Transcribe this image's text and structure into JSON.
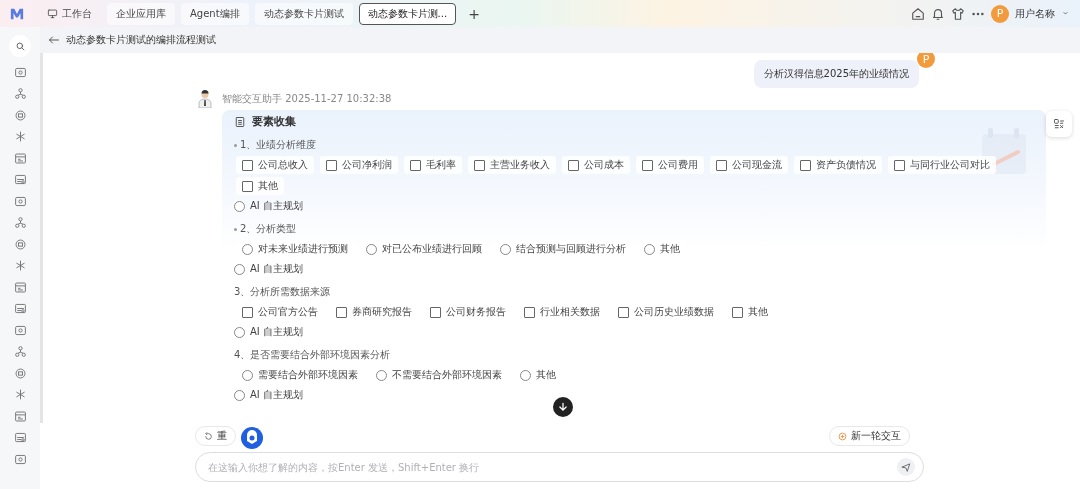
{
  "top_bar": {
    "tabs": [
      {
        "kind": "home",
        "label": "工作台",
        "selected": false
      },
      {
        "kind": "tab",
        "label": "企业应用库",
        "selected": false
      },
      {
        "kind": "tab",
        "label": "Agent编排",
        "selected": false
      },
      {
        "kind": "tab",
        "label": "动态参数卡片测试",
        "selected": false
      },
      {
        "kind": "tab",
        "label": "动态参数卡片测...",
        "selected": true
      }
    ],
    "add_tab": "+",
    "user": {
      "avatar": "P",
      "name": "用户名称"
    }
  },
  "page_header": {
    "title": "动态参数卡片测试的编排流程测试"
  },
  "user_message": {
    "avatar": "P",
    "text": "分析汉得信息2025年的业绩情况"
  },
  "bot_message": {
    "meta": "智能交互助手 2025-11-27 10:32:38",
    "card": {
      "title": "要素收集",
      "sections": [
        {
          "title": "1、业绩分析维度",
          "required": true,
          "kind": "checkbox",
          "options": [
            {
              "label": "公司总收入",
              "checked": false
            },
            {
              "label": "公司净利润",
              "checked": false
            },
            {
              "label": "毛利率",
              "checked": false
            },
            {
              "label": "主营业务收入",
              "checked": false
            },
            {
              "label": "公司成本",
              "checked": false
            },
            {
              "label": "公司费用",
              "checked": false
            },
            {
              "label": "公司现金流",
              "checked": false
            },
            {
              "label": "资产负债情况",
              "checked": false
            },
            {
              "label": "与同行业公司对比",
              "checked": false
            },
            {
              "label": "其他",
              "checked": false
            }
          ],
          "auto": {
            "label": "AI 自主规划",
            "selected": false
          }
        },
        {
          "title": "2、分析类型",
          "required": true,
          "kind": "radio",
          "options": [
            {
              "label": "对未来业绩进行预测",
              "checked": false
            },
            {
              "label": "对已公布业绩进行回顾",
              "checked": false
            },
            {
              "label": "结合预测与回顾进行分析",
              "checked": false
            },
            {
              "label": "其他",
              "checked": false
            }
          ],
          "auto": {
            "label": "AI 自主规划",
            "selected": false
          }
        },
        {
          "title": "3、分析所需数据来源",
          "required": false,
          "kind": "checkbox",
          "options": [
            {
              "label": "公司官方公告",
              "checked": false
            },
            {
              "label": "券商研究报告",
              "checked": false
            },
            {
              "label": "公司财务报告",
              "checked": false
            },
            {
              "label": "行业相关数据",
              "checked": false
            },
            {
              "label": "公司历史业绩数据",
              "checked": false
            },
            {
              "label": "其他",
              "checked": false
            }
          ],
          "auto": {
            "label": "AI 自主规划",
            "selected": false
          }
        },
        {
          "title": "4、是否需要结合外部环境因素分析",
          "required": false,
          "kind": "radio",
          "options": [
            {
              "label": "需要结合外部环境因素",
              "checked": false
            },
            {
              "label": "不需要结合外部环境因素",
              "checked": false
            },
            {
              "label": "其他",
              "checked": false
            }
          ],
          "auto": {
            "label": "AI 自主规划",
            "selected": false
          }
        }
      ]
    }
  },
  "actions": {
    "retry": "重",
    "new_round": "新一轮交互"
  },
  "input": {
    "placeholder": "在这输入你想了解的内容，按Enter 发送，Shift+Enter 换行"
  }
}
